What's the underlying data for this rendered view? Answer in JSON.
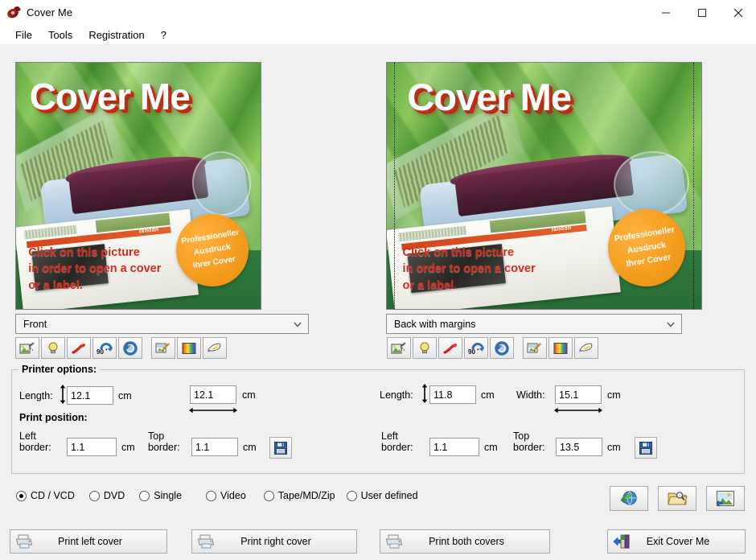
{
  "window": {
    "title": "Cover Me",
    "icon": "cover-me-disc-icon",
    "controls": {
      "minimize": "minimize-icon",
      "maximize": "maximize-icon",
      "close": "close-icon"
    }
  },
  "menu": {
    "items": [
      "File",
      "Tools",
      "Registration",
      "?"
    ]
  },
  "previews": {
    "left": {
      "title": "Cover Me",
      "message_lines": [
        "Click on this picture",
        "in order to open a cover",
        "or a label."
      ],
      "badge_lines": [
        "Professioneller",
        "Ausdruck",
        "Ihrer Cover"
      ],
      "paper_label": "fandan",
      "guides": false
    },
    "right": {
      "title": "Cover Me",
      "message_lines": [
        "Click on this picture",
        "in order to open a cover",
        "or a label."
      ],
      "badge_lines": [
        "Professioneller",
        "Ausdruck",
        "Ihrer Cover"
      ],
      "paper_label": "fandan",
      "guides": true
    }
  },
  "selectors": {
    "left": {
      "value": "Front",
      "chevron": "chevron-down-icon"
    },
    "right": {
      "value": "Back with margins",
      "chevron": "chevron-down-icon"
    }
  },
  "icon_toolbar": {
    "buttons": [
      "image-effects-icon",
      "brightness-bulb-icon",
      "red-brush-icon",
      "rotate-90-icon",
      "undo-refresh-icon",
      "edit-picture-icon",
      "color-palette-icon",
      "paint-fill-icon"
    ],
    "rotate_label": "90"
  },
  "printer_options": {
    "group_title": "Printer options:",
    "print_position_title": "Print position:",
    "left_panel": {
      "length_label": "Length:",
      "length_value": "12.1",
      "length_unit": "cm",
      "width_value": "12.1",
      "width_unit": "cm",
      "left_border_label": [
        "Left",
        "border:"
      ],
      "left_border_value": "1.1",
      "left_border_unit": "cm",
      "top_border_label": [
        "Top",
        "border:"
      ],
      "top_border_value": "1.1",
      "top_border_unit": "cm",
      "save_icon": "floppy-save-icon"
    },
    "right_panel": {
      "length_label": "Length:",
      "length_value": "11.8",
      "length_unit": "cm",
      "width_label": "Width:",
      "width_value": "15.1",
      "width_unit": "cm",
      "left_border_label": [
        "Left",
        "border:"
      ],
      "left_border_value": "1.1",
      "left_border_unit": "cm",
      "top_border_label": [
        "Top",
        "border:"
      ],
      "top_border_value": "13.5",
      "top_border_unit": "cm",
      "save_icon": "floppy-save-icon"
    }
  },
  "media_types": {
    "selected": "CD / VCD",
    "options": [
      "CD / VCD",
      "DVD",
      "Single",
      "Video",
      "Tape/MD/Zip",
      "User defined"
    ]
  },
  "action_buttons": [
    {
      "icon": "internet-globe-icon"
    },
    {
      "icon": "open-folder-search-icon"
    },
    {
      "icon": "picture-export-icon"
    }
  ],
  "bottom_buttons": {
    "print_left": {
      "label": "Print left cover",
      "icon": "printer-icon"
    },
    "print_right": {
      "label": "Print right cover",
      "icon": "printer-icon"
    },
    "print_both": {
      "label": "Print both covers",
      "icon": "printer-icon"
    },
    "exit": {
      "label": "Exit Cover Me",
      "icon": "exit-door-icon"
    }
  },
  "colors": {
    "window_bg": "#f0f0f0",
    "title_bar": "#ffffff",
    "cover_title_text": "#ffffff",
    "cover_title_shadow": "#c62b12",
    "cover_message": "#d42a16",
    "badge": "#f59d1f",
    "art_green": "#6fb347"
  }
}
